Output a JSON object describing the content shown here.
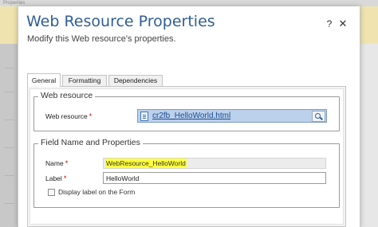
{
  "background": {
    "top_strip_text": "Properties"
  },
  "dialog": {
    "title": "Web Resource Properties",
    "subtitle": "Modify this Web resource's properties.",
    "help_label": "?",
    "close_label": "✕"
  },
  "tabs": [
    {
      "label": "General",
      "active": true
    },
    {
      "label": "Formatting",
      "active": false
    },
    {
      "label": "Dependencies",
      "active": false
    }
  ],
  "web_resource_section": {
    "legend": "Web resource",
    "field_label": "Web resource",
    "required_mark": "*",
    "value": "cr2fb_HelloWorld.html",
    "icon": "file-icon",
    "lookup_icon": "lookup-icon"
  },
  "field_section": {
    "legend": "Field Name and Properties",
    "name_label": "Name",
    "name_required_mark": "*",
    "name_value": "WebResource_HelloWorld",
    "label_label": "Label",
    "label_required_mark": "*",
    "label_value": "HelloWorld",
    "checkbox_label": "Display label on the Form",
    "checkbox_checked": false
  },
  "colors": {
    "title_blue": "#2f5d97",
    "highlight_yellow": "#ffff3b",
    "required_red": "#c00000",
    "selected_lookup_bg": "#bcd1ec"
  }
}
